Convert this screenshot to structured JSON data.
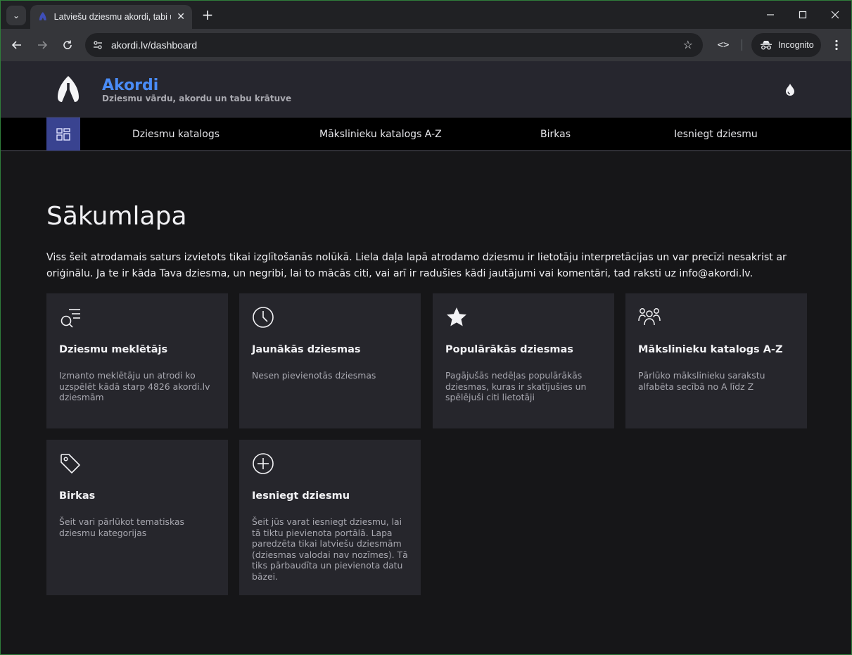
{
  "browser": {
    "tab_title": "Latviešu dziesmu akordi, tabi un",
    "tab_close": "✕",
    "new_tab": "+",
    "url": "akordi.lv/dashboard",
    "incognito_label": "Incognito",
    "devtools_label": "<>"
  },
  "site": {
    "brand": "Akordi",
    "tagline": "Dziesmu vārdu, akordu un tabu krātuve",
    "brand_color": "#4a8cf7"
  },
  "nav": {
    "items": [
      {
        "label": "Dziesmu katalogs"
      },
      {
        "label": "Mākslinieku katalogs A-Z"
      },
      {
        "label": "Birkas"
      },
      {
        "label": "Iesniegt dziesmu"
      }
    ]
  },
  "main": {
    "title": "Sākumlapa",
    "intro": "Viss šeit atrodamais saturs izvietots tikai izglītošanās nolūkā. Liela daļa lapā atrodamo dziesmu ir lietotāju interpretācijas un var precīzi nesakrist ar oriģinālu. Ja te ir kāda Tava dziesma, un negribi, lai to mācās citi, vai arī ir radušies kādi jautājumi vai komentāri, tad raksti uz info@akordi.lv.",
    "cards": [
      {
        "icon": "search-list-icon",
        "title": "Dziesmu meklētājs",
        "desc": "Izmanto meklētāju un atrodi ko uzspēlēt kādā starp 4826 akordi.lv dziesmām"
      },
      {
        "icon": "clock-icon",
        "title": "Jaunākās dziesmas",
        "desc": "Nesen pievienotās dziesmas"
      },
      {
        "icon": "star-icon",
        "title": "Populārākās dziesmas",
        "desc": "Pagājušās nedēļas populārākās dziesmas, kuras ir skatījušies un spēlējuši citi lietotāji"
      },
      {
        "icon": "users-icon",
        "title": "Mākslinieku katalogs A-Z",
        "desc": "Pārlūko mākslinieku sarakstu alfabēta secībā no A līdz Z"
      },
      {
        "icon": "tag-icon",
        "title": "Birkas",
        "desc": "Šeit vari pārlūkot tematiskas dziesmu kategorijas"
      },
      {
        "icon": "plus-circle-icon",
        "title": "Iesniegt dziesmu",
        "desc": "Šeit jūs varat iesniegt dziesmu, lai tā tiktu pievienota portālā. Lapa paredzēta tikai latviešu dziesmām (dziesmas valodai nav nozīmes). Tā tiks pārbaudīta un pievienota datu bāzei."
      }
    ]
  }
}
